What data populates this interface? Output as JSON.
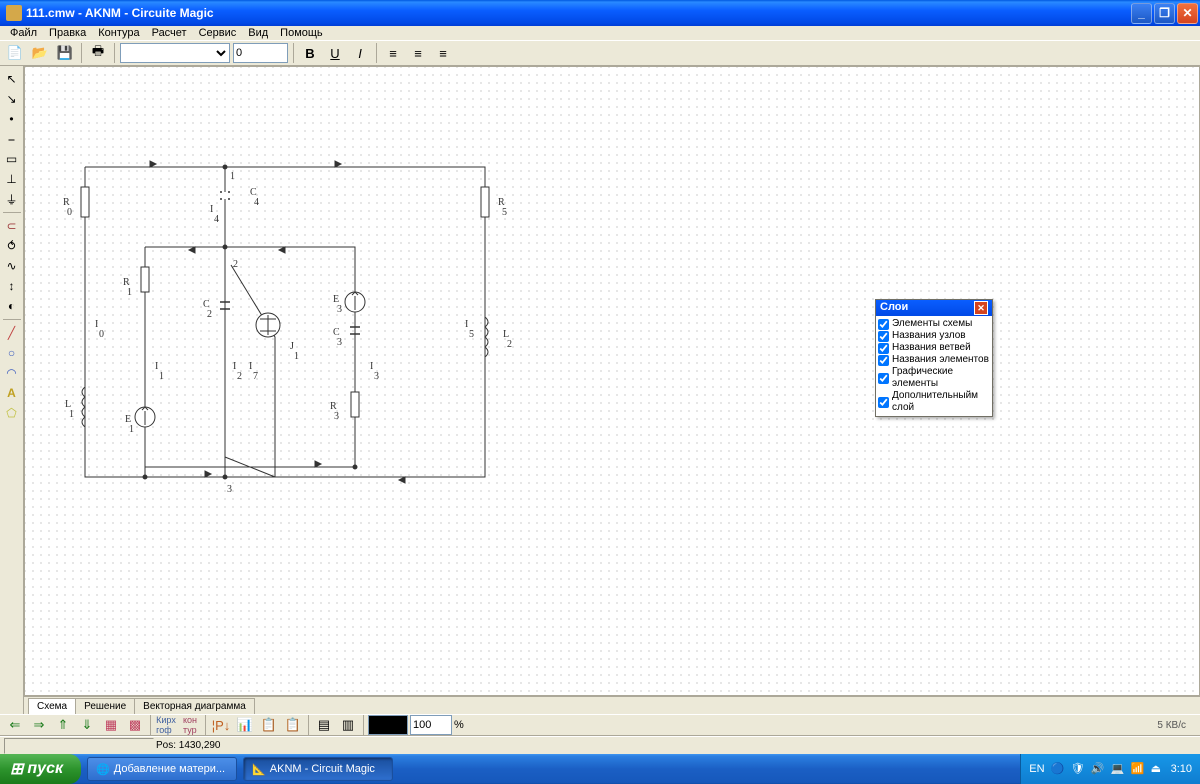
{
  "title": "111.cmw - AKNM - Circuite Magic",
  "menu": [
    "Файл",
    "Правка",
    "Контура",
    "Расчет",
    "Сервис",
    "Вид",
    "Помощь"
  ],
  "toolbar": {
    "font": "",
    "size": "0"
  },
  "layers": {
    "title": "Слои",
    "items": [
      "Элементы схемы",
      "Названия узлов",
      "Названия ветвей",
      "Названия элементов",
      "Графические элементы",
      "Дополнительныйм слой"
    ]
  },
  "bottomtabs": [
    "Схема",
    "Решение",
    "Векторная диаграмма"
  ],
  "zoom": "100",
  "status": {
    "pos": "Pos: 1430,290"
  },
  "speed": "5 КВ/с",
  "taskbar": {
    "start": "пуск",
    "tasks": [
      "Добавление матери...",
      "AKNM - Circuit Magic"
    ],
    "lang": "EN",
    "time": "3:10"
  },
  "circuit": {
    "nodes": [
      "1",
      "2",
      "3"
    ],
    "labels": {
      "R0": "R\n0",
      "R1": "R\n1",
      "R3": "R\n3",
      "R5": "R\n5",
      "C2": "C\n2",
      "C3": "C\n3",
      "C4": "C\n4",
      "L1": "L\n1",
      "L2": "L\n2",
      "E1": "E\n1",
      "E3": "E\n3",
      "J1": "J\n1",
      "I0": "I\n0",
      "I1": "I\n1",
      "I2": "I\n2",
      "I3": "I\n3",
      "I4": "I\n4",
      "I5": "I\n5",
      "I7": "I\n7"
    }
  }
}
